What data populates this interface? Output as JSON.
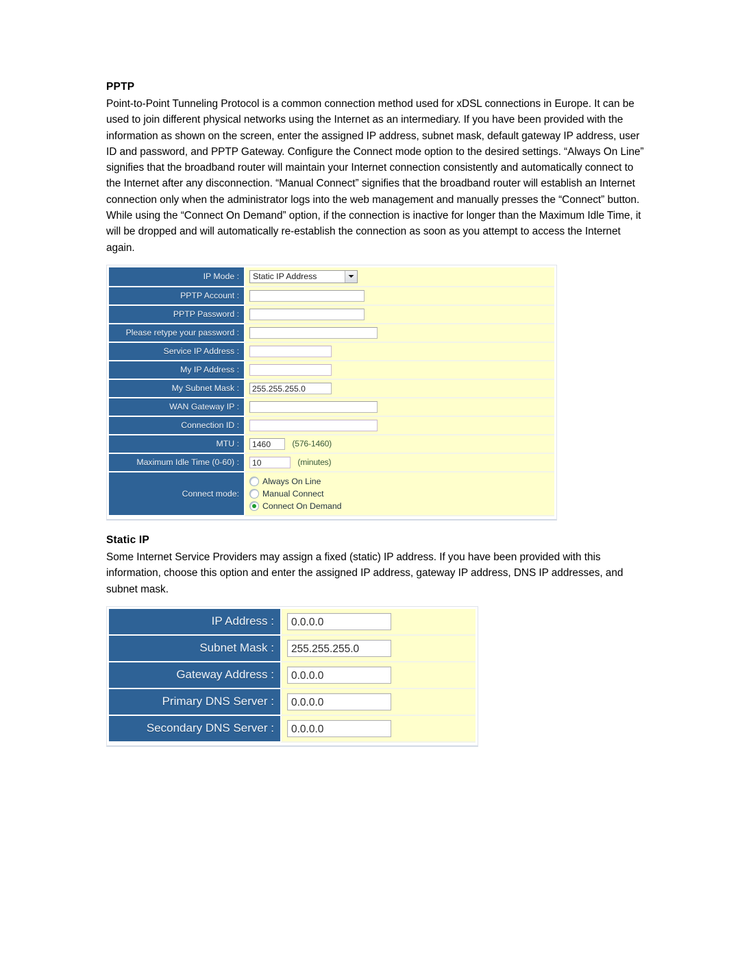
{
  "pptp": {
    "heading": "PPTP",
    "paragraph": "Point-to-Point Tunneling Protocol is a common connection method used for xDSL connections in Europe. It can be used to join different physical networks using the Internet as an intermediary. If you have been provided with the information as shown on the screen, enter the assigned IP address, subnet mask, default gateway IP address, user ID and password, and PPTP Gateway. Configure the Connect mode option to the desired settings. “Always On Line” signifies that the broadband router will maintain your Internet connection consistently and automatically connect to the Internet after any disconnection. “Manual Connect” signifies that the broadband router will establish an Internet connection only when the administrator logs into the web management and manually presses the “Connect” button. While using the “Connect On Demand” option, if the connection is inactive for longer than the Maximum Idle Time, it will be dropped and will automatically re-establish the connection as soon as you attempt to access the Internet again.",
    "form": {
      "ip_mode": {
        "label": "IP Mode :",
        "selected": "Static IP Address"
      },
      "pptp_account": {
        "label": "PPTP Account :",
        "value": ""
      },
      "pptp_password": {
        "label": "PPTP Password :",
        "value": ""
      },
      "retype_password": {
        "label": "Please retype your password :",
        "value": ""
      },
      "service_ip": {
        "label": "Service IP Address :",
        "value": ""
      },
      "my_ip": {
        "label": "My IP Address :",
        "value": ""
      },
      "my_subnet_mask": {
        "label": "My Subnet Mask :",
        "value": "255.255.255.0"
      },
      "wan_gateway_ip": {
        "label": "WAN Gateway IP :",
        "value": ""
      },
      "connection_id": {
        "label": "Connection ID :",
        "value": ""
      },
      "mtu": {
        "label": "MTU :",
        "value": "1460",
        "hint": "(576-1460)"
      },
      "max_idle_time": {
        "label": "Maximum Idle Time (0-60) :",
        "value": "10",
        "hint": "(minutes)"
      },
      "connect_mode": {
        "label": "Connect mode:",
        "options": [
          {
            "label": "Always On Line",
            "selected": false
          },
          {
            "label": "Manual Connect",
            "selected": false
          },
          {
            "label": "Connect On Demand",
            "selected": true
          }
        ]
      }
    }
  },
  "static_ip": {
    "heading": "Static IP",
    "paragraph": "Some Internet Service Providers may assign a fixed (static) IP address. If you have been provided with this information, choose this option and enter the assigned IP address, gateway IP address, DNS IP addresses, and subnet mask.",
    "form": {
      "ip_address": {
        "label": "IP Address :",
        "value": "0.0.0.0"
      },
      "subnet_mask": {
        "label": "Subnet Mask :",
        "value": "255.255.255.0"
      },
      "gateway_address": {
        "label": "Gateway Address :",
        "value": "0.0.0.0"
      },
      "primary_dns": {
        "label": "Primary DNS Server :",
        "value": "0.0.0.0"
      },
      "secondary_dns": {
        "label": "Secondary DNS Server :",
        "value": "0.0.0.0"
      }
    }
  },
  "colors": {
    "label_blue": "#2E6296",
    "field_yellow": "#FFFFCC",
    "radio_selected_green": "#1F9D2E"
  }
}
